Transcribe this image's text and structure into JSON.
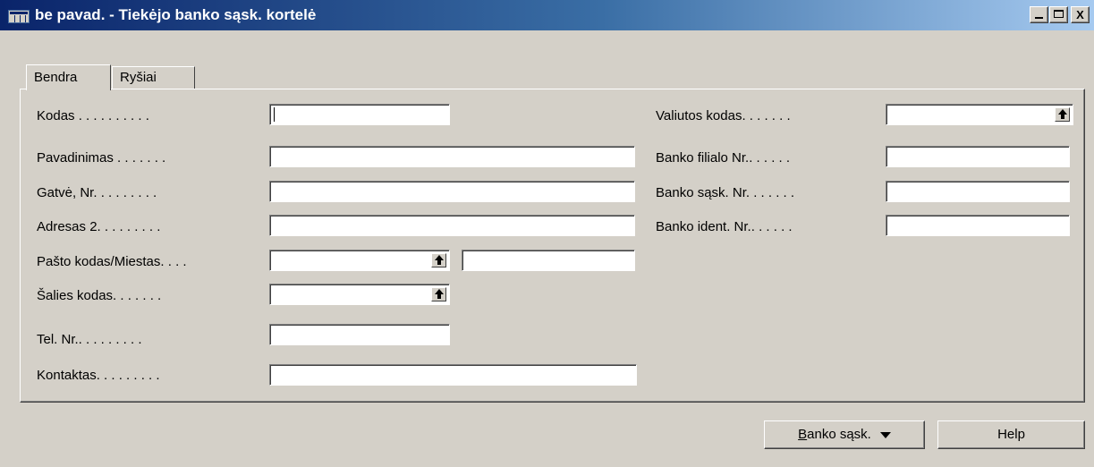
{
  "window": {
    "title": "be pavad. - Tiekėjo banko sąsk. kortelė",
    "min_icon": "minimize-icon",
    "max_icon": "maximize-icon",
    "close_label": "X"
  },
  "tabs": [
    {
      "label": "Bendra",
      "active": true
    },
    {
      "label": "Ryšiai",
      "active": false
    }
  ],
  "form_left": [
    {
      "label": "Kodas . . . . . . . . . .",
      "value": ""
    },
    {
      "label": "Pavadinimas . . . . . . .",
      "value": ""
    },
    {
      "label": "Gatvė, Nr. . . . . . . . .",
      "value": ""
    },
    {
      "label": "Adresas 2. . . . . . . . .",
      "value": ""
    },
    {
      "label": "Pašto kodas/Miestas. . . .",
      "value": "",
      "value2": ""
    },
    {
      "label": "Šalies kodas. . . . . . .",
      "value": ""
    },
    {
      "label": "Tel. Nr.. . . . . . . . .",
      "value": ""
    },
    {
      "label": "Kontaktas. . . . . . . . .",
      "value": ""
    }
  ],
  "form_right": [
    {
      "label": "Valiutos kodas. . . . . . .",
      "value": ""
    },
    {
      "label": "Banko filialo Nr.. . . . . .",
      "value": ""
    },
    {
      "label": "Banko sąsk. Nr. . . . . . .",
      "value": ""
    },
    {
      "label": "Banko ident. Nr.. . . . . .",
      "value": ""
    }
  ],
  "buttons": {
    "banko_mnemonic": "B",
    "banko_rest": "anko sąsk.",
    "help": "Help"
  },
  "icons": {
    "app": "app-form-icon",
    "lookup": "lookup-arrow-icon",
    "dropdown": "dropdown-arrow-icon"
  }
}
